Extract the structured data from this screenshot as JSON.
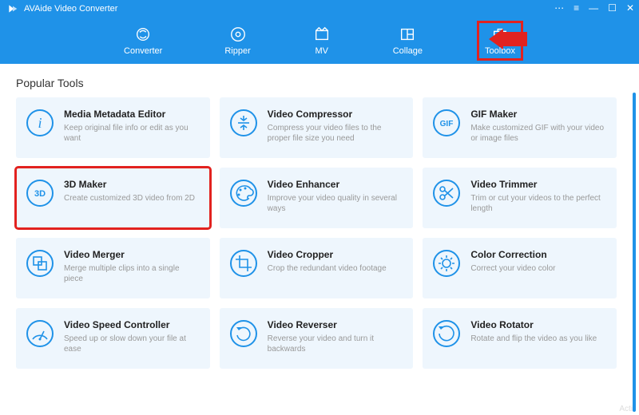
{
  "app_title": "AVAide Video Converter",
  "window_controls": [
    "chat",
    "menu",
    "min",
    "max",
    "close"
  ],
  "tabs": [
    {
      "label": "Converter"
    },
    {
      "label": "Ripper"
    },
    {
      "label": "MV"
    },
    {
      "label": "Collage"
    },
    {
      "label": "Toolbox"
    }
  ],
  "section_title": "Popular Tools",
  "tools": [
    {
      "icon": "i",
      "title": "Media Metadata Editor",
      "desc": "Keep original file info or edit as you want"
    },
    {
      "icon": "compress",
      "title": "Video Compressor",
      "desc": "Compress your video files to the proper file size you need"
    },
    {
      "icon": "GIF",
      "title": "GIF Maker",
      "desc": "Make customized GIF with your video or image files"
    },
    {
      "icon": "3D",
      "title": "3D Maker",
      "desc": "Create customized 3D video from 2D"
    },
    {
      "icon": "palette",
      "title": "Video Enhancer",
      "desc": "Improve your video quality in several ways"
    },
    {
      "icon": "scissors",
      "title": "Video Trimmer",
      "desc": "Trim or cut your videos to the perfect length"
    },
    {
      "icon": "merge",
      "title": "Video Merger",
      "desc": "Merge multiple clips into a single piece"
    },
    {
      "icon": "crop",
      "title": "Video Cropper",
      "desc": "Crop the redundant video footage"
    },
    {
      "icon": "sun",
      "title": "Color Correction",
      "desc": "Correct your video color"
    },
    {
      "icon": "speed",
      "title": "Video Speed Controller",
      "desc": "Speed up or slow down your file at ease"
    },
    {
      "icon": "reverse",
      "title": "Video Reverser",
      "desc": "Reverse your video and turn it backwards"
    },
    {
      "icon": "rotate",
      "title": "Video Rotator",
      "desc": "Rotate and flip the video as you like"
    }
  ],
  "activate_text": "Acti"
}
